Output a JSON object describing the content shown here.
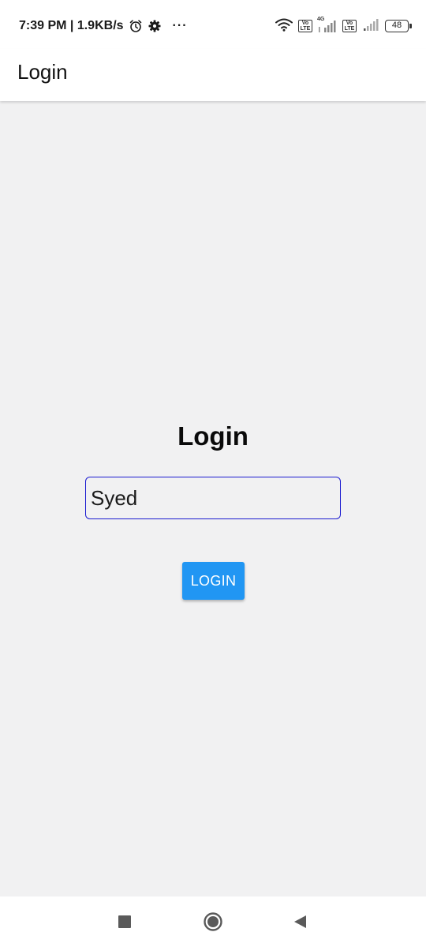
{
  "status_bar": {
    "time_speed": "7:39 PM | 1.9KB/s",
    "more": "···",
    "volte_label": "Vo LTE",
    "network_type": "4G",
    "battery_level": "48",
    "icons": [
      "alarm-icon",
      "gear-icon",
      "wifi-icon",
      "signal-icon",
      "battery-icon"
    ]
  },
  "app_bar": {
    "title": "Login"
  },
  "main": {
    "heading": "Login",
    "username_value": "Syed",
    "login_button_label": "LOGIN"
  },
  "nav_bar": {
    "icons": [
      "recents-icon",
      "home-icon",
      "back-icon"
    ]
  },
  "colors": {
    "background": "#f1f1f2",
    "primary_button": "#2196f3",
    "input_border": "#1b1bd0"
  }
}
